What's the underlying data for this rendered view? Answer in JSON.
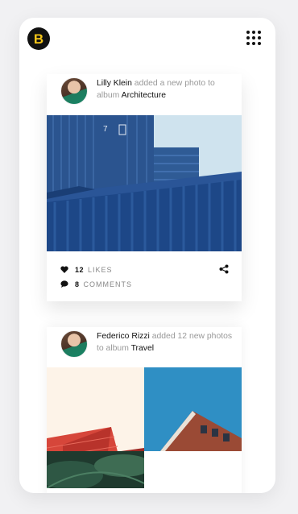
{
  "header": {
    "logo_letter": "B",
    "logo_color": "#f5c518",
    "menu_icon": "grid-dots-icon"
  },
  "posts": [
    {
      "user": "Lilly Klein",
      "action": "added a new photo to album",
      "album": "Architecture",
      "likes_count": "12",
      "likes_label": "LIKES",
      "comments_count": "8",
      "comments_label": "COMMENTS",
      "icons": [
        "heart-icon",
        "comment-icon",
        "share-icon"
      ]
    },
    {
      "user": "Federico Rizzi",
      "action": "added 12 new photos to album",
      "album": "Travel"
    }
  ],
  "colors": {
    "container_blue": "#1f4a8a",
    "accent_black": "#111111"
  }
}
